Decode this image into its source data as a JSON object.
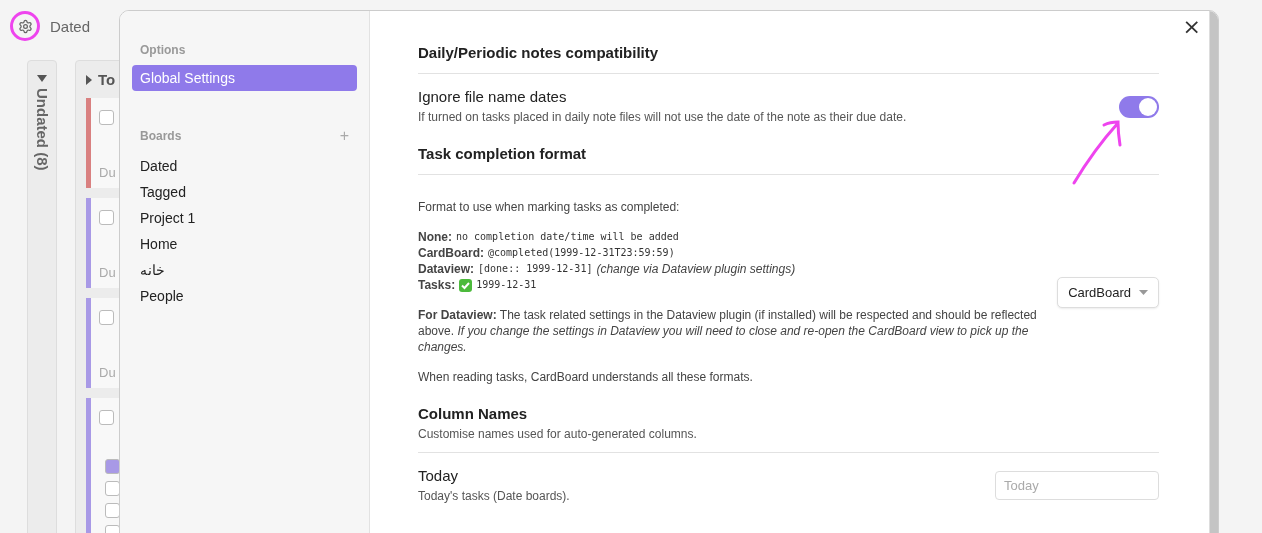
{
  "board": {
    "title": "Dated",
    "columns": [
      {
        "title": "Undated (8)"
      },
      {
        "title": "To",
        "cards": [
          {
            "color": "#d98080",
            "due": "Du"
          },
          {
            "color": "#a899e6",
            "due": "Du"
          },
          {
            "color": "#a899e6",
            "due": "Du"
          },
          {
            "color": "#a899e6",
            "subtasks": [
              {
                "checked": true
              },
              {
                "checked": false
              },
              {
                "checked": false
              },
              {
                "checked": false
              }
            ]
          }
        ]
      }
    ]
  },
  "settings_dialog": {
    "sidebar": {
      "options_heading": "Options",
      "options": [
        {
          "label": "Global Settings",
          "selected": true
        }
      ],
      "boards_heading": "Boards",
      "add_button": "+",
      "boards": [
        {
          "label": "Dated",
          "selected": false
        },
        {
          "label": "Tagged",
          "selected": false
        },
        {
          "label": "Project 1",
          "selected": false
        },
        {
          "label": "Home",
          "selected": false
        },
        {
          "label": "خانه",
          "selected": false
        },
        {
          "label": "People",
          "selected": false
        }
      ]
    },
    "close_button": "×",
    "sections": [
      {
        "kind": "toggle",
        "heading": "Daily/Periodic notes compatibility",
        "name": "Ignore file name dates",
        "description": "If turned on tasks placed in daily note files will not use the date of the note as their due date.",
        "on": true
      },
      {
        "kind": "select",
        "heading": "Task completion format",
        "intro": "Format to use when marking tasks as completed:",
        "formats": [
          {
            "label": "None:",
            "code": "no completion date/time will be added"
          },
          {
            "label": "CardBoard:",
            "code": "@completed(1999-12-31T23:59:59)"
          },
          {
            "label": "Dataview:",
            "code": "[done:: 1999-12-31]",
            "note": "(change via Dataview plugin settings)"
          },
          {
            "label": "Tasks:",
            "code": "1999-12-31",
            "check_mark": true
          }
        ],
        "note": "**For Dataview:** The task related settings in the Dataview plugin (if installed) will be respected and should be reflected above. *If you change the settings in Dataview you will need to close and re-open the CardBoard view to pick up the changes.*",
        "footer": "When reading tasks, CardBoard understands all these formats.",
        "value": "CardBoard"
      },
      {
        "kind": "inputs",
        "heading": "Column Names",
        "description": "Customise names used for auto-generated columns.",
        "fields": [
          {
            "name": "Today",
            "description": "Today's tasks (Date boards).",
            "placeholder": "Today"
          }
        ]
      }
    ]
  }
}
